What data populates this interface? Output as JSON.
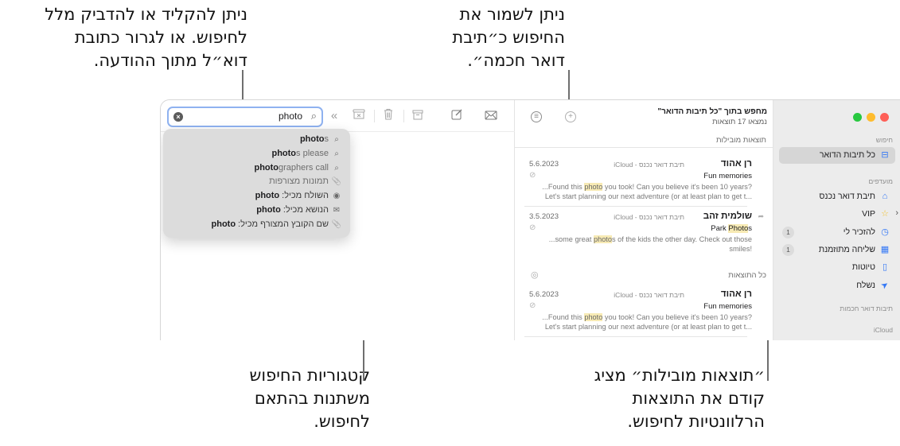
{
  "callouts": {
    "search_field": [
      "ניתן להקליד או להדביק מלל",
      "לחיפוש. או לגרור כתובת",
      "דוא״ל מתוך ההודעה."
    ],
    "save_smart_mailbox": [
      "ניתן לשמור את",
      "החיפוש כ״תיבת",
      "דואר חכמה״."
    ],
    "categories": [
      "קטגוריות החיפוש",
      "משתנות בהתאם",
      "לחיפוש."
    ],
    "top_hits": [
      "״תוצאות מובילות״ מציג",
      "קודם את התוצאות",
      "הרלוונטיות לחיפוש."
    ]
  },
  "toolbar": {
    "search_query": "photo",
    "clear_icon": "x-circle-icon",
    "search_icon": "magnifier-icon",
    "collapse_icon": "«",
    "junk_icon": "junk-icon",
    "trash_icon": "trash-icon",
    "archive_icon": "archive-icon",
    "compose_icon": "compose-icon",
    "mail_icon": "envelope-icon"
  },
  "suggestions": [
    {
      "bold": "photo",
      "rest": "s",
      "icon": "search",
      "glyph": "⌕"
    },
    {
      "bold": "photo",
      "rest": "s please",
      "icon": "search",
      "glyph": "⌕"
    },
    {
      "bold": "photo",
      "rest": "graphers call",
      "icon": "search",
      "glyph": "⌕"
    },
    {
      "label": "תמונות מצורפות",
      "icon": "paperclip",
      "glyph": "📎"
    },
    {
      "label": "השולח מכיל:",
      "query": "photo",
      "icon": "person-circle",
      "glyph": "◉"
    },
    {
      "label": "הנושא מכיל:",
      "query": "photo",
      "icon": "envelope",
      "glyph": "✉"
    },
    {
      "label": "שם הקובץ המצורף מכיל:",
      "query": "photo",
      "icon": "paperclip",
      "glyph": "📎"
    }
  ],
  "results": {
    "title": "מחפש בתוך \"כל תיבות הדואר\"",
    "count": "נמצאו 17 תוצאות",
    "add_icon": "+",
    "filter_icon": "≡",
    "top_hits_label": "תוצאות מובילות",
    "all_results_label": "כל התוצאות",
    "top_hits": [
      {
        "sender": "רן אהוד",
        "mailbox": "תיבת דואר נכנס - iCloud",
        "date": "5.6.2023",
        "subject": "Fun memories",
        "preview_pre": "...Found this ",
        "preview_hl": "photo",
        "preview_post": " you took! Can you believe it's been 10 years? Let's start planning our next adventure (or at least plan to get t..."
      },
      {
        "sender": "שולמית זהב",
        "mailbox": "תיבת דואר נכנס - iCloud",
        "date": "3.5.2023",
        "subject_pre": "Park ",
        "subject_hl": "Photo",
        "subject_post": "s",
        "preview_pre": "...some great ",
        "preview_hl": "photo",
        "preview_post": "s of the kids the other day. Check out those smiles!"
      }
    ],
    "all_results": [
      {
        "sender": "רן אהוד",
        "mailbox": "תיבת דואר נכנס - iCloud",
        "date": "5.6.2023",
        "subject": "Fun memories",
        "preview_pre": "...Found this ",
        "preview_hl": "photo",
        "preview_post": " you took! Can you believe it's been 10 years? Let's start planning our next adventure (or at least plan to get t..."
      }
    ]
  },
  "sidebar": {
    "traffic_colors": {
      "close": "#fe5f57",
      "minimize": "#febc2e",
      "zoom": "#28c840"
    },
    "search_section": "חיפוש",
    "search_item": "כל תיבות הדואר",
    "favorites_section": "מועדפים",
    "favorites": [
      {
        "label": "תיבת דואר נכנס",
        "icon": "inbox-icon",
        "glyph": "⌂"
      },
      {
        "label": "VIP",
        "icon": "star-icon",
        "glyph": "☆",
        "chevron": "‹"
      },
      {
        "label": "להזכיר לי",
        "icon": "clock-icon",
        "glyph": "◷",
        "badge": "1"
      },
      {
        "label": "שליחה מתוזמנת",
        "icon": "calendar-icon",
        "glyph": "▦",
        "badge": "1"
      },
      {
        "label": "טיוטות",
        "icon": "document-icon",
        "glyph": "▯"
      },
      {
        "label": "נשלח",
        "icon": "paperplane-icon",
        "glyph": "➤"
      }
    ],
    "smart_mailboxes_section": "תיבות דואר חכמות",
    "icloud_section": "iCloud"
  },
  "colors": {
    "accent": "#3478f6",
    "search_focus": "#8fb2f0",
    "highlight": "#f7eab4",
    "sidebar_bg": "#ececec"
  }
}
